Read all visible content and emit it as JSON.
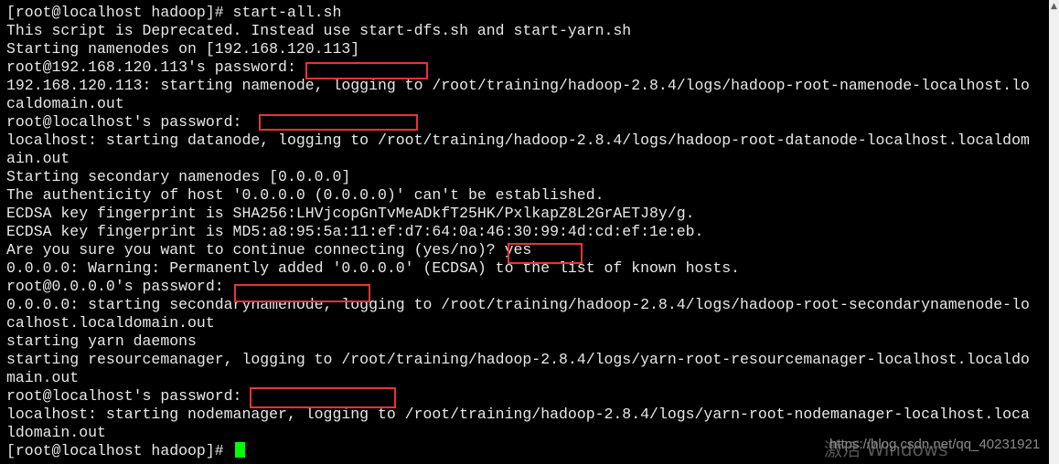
{
  "terminal": {
    "lines": [
      "[root@localhost hadoop]# start-all.sh",
      "This script is Deprecated. Instead use start-dfs.sh and start-yarn.sh",
      "Starting namenodes on [192.168.120.113]",
      "root@192.168.120.113's password: ",
      "192.168.120.113: starting namenode, logging to /root/training/hadoop-2.8.4/logs/hadoop-root-namenode-localhost.lo",
      "caldomain.out",
      "root@localhost's password: ",
      "localhost: starting datanode, logging to /root/training/hadoop-2.8.4/logs/hadoop-root-datanode-localhost.localdom",
      "ain.out",
      "Starting secondary namenodes [0.0.0.0]",
      "The authenticity of host '0.0.0.0 (0.0.0.0)' can't be established.",
      "ECDSA key fingerprint is SHA256:LHVjcopGnTvMeADkfT25HK/PxlkapZ8L2GrAETJ8y/g.",
      "ECDSA key fingerprint is MD5:a8:95:5a:11:ef:d7:64:0a:46:30:99:4d:cd:ef:1e:eb.",
      "Are you sure you want to continue connecting (yes/no)? yes",
      "0.0.0.0: Warning: Permanently added '0.0.0.0' (ECDSA) to the list of known hosts.",
      "root@0.0.0.0's password: ",
      "0.0.0.0: starting secondarynamenode, logging to /root/training/hadoop-2.8.4/logs/hadoop-root-secondarynamenode-lo",
      "calhost.localdomain.out",
      "starting yarn daemons",
      "starting resourcemanager, logging to /root/training/hadoop-2.8.4/logs/yarn-root-resourcemanager-localhost.localdo",
      "main.out",
      "root@localhost's password: ",
      "localhost: starting nodemanager, logging to /root/training/hadoop-2.8.4/logs/yarn-root-nodemanager-localhost.loca",
      "ldomain.out"
    ],
    "prompt": "[root@localhost hadoop]# ",
    "cursor_color": "#00ff00",
    "redaction_color": "#e8333a"
  },
  "watermark": {
    "url": "https://blog.csdn.net/qq_40231921",
    "activation": "激活 Windows"
  }
}
